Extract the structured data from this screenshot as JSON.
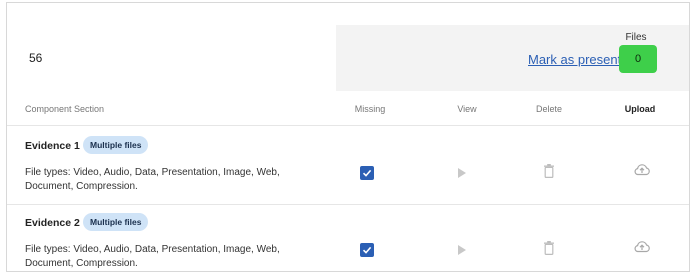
{
  "form": {
    "number_value": "56",
    "mark_present_label": "Mark as present",
    "files_label": "Files",
    "files_count": "0"
  },
  "table": {
    "headers": {
      "component": "Component Section",
      "missing": "Missing",
      "view": "View",
      "delete": "Delete",
      "upload": "Upload"
    },
    "rows": [
      {
        "title": "Evidence 1",
        "badge": "Multiple files",
        "file_types": "File types: Video, Audio, Data, Presentation, Image, Web, Document, Compression.",
        "missing_checked": true
      },
      {
        "title": "Evidence 2",
        "badge": "Multiple files",
        "file_types": "File types: Video, Audio, Data, Presentation, Image, Web, Document, Compression.",
        "missing_checked": true
      }
    ]
  },
  "colors": {
    "accent": "#2b5fb4",
    "files_badge": "#3ecf4a",
    "pill_bg": "#cfe3f7"
  }
}
